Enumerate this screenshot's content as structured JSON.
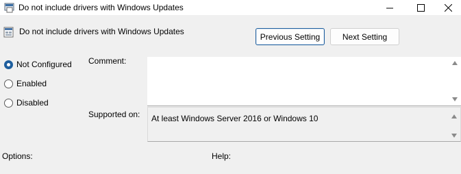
{
  "window": {
    "title": "Do not include drivers with Windows Updates",
    "minimize_icon": "minimize-icon",
    "maximize_icon": "maximize-icon",
    "close_icon": "close-icon"
  },
  "header": {
    "policy_name": "Do not include drivers with Windows Updates",
    "previous_label": "Previous Setting",
    "next_label": "Next Setting"
  },
  "state": {
    "options": [
      "Not Configured",
      "Enabled",
      "Disabled"
    ],
    "selected": "Not Configured"
  },
  "comment": {
    "label": "Comment:",
    "value": ""
  },
  "supported": {
    "label": "Supported on:",
    "value": "At least Windows Server 2016 or Windows 10"
  },
  "sections": {
    "options_label": "Options:",
    "help_label": "Help:"
  },
  "colors": {
    "accent": "#1f5f9e",
    "background": "#f0f0f0"
  }
}
